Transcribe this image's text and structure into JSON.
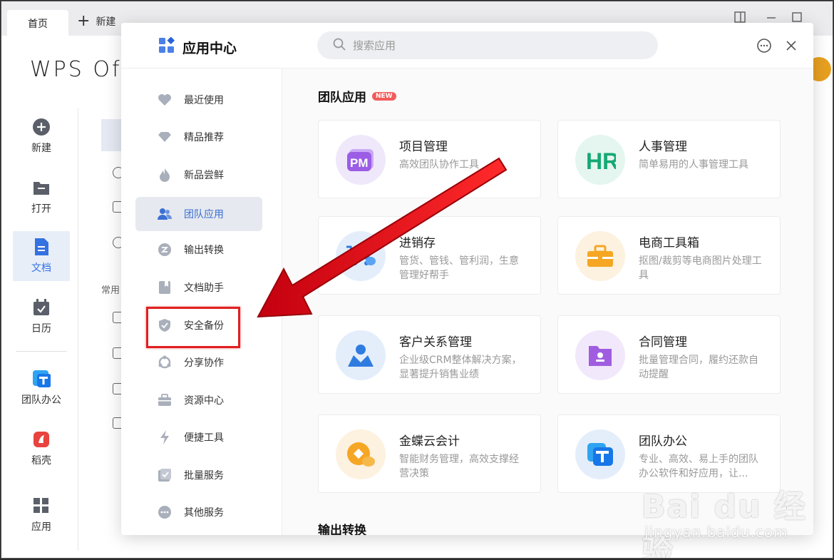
{
  "tabs": {
    "home": "首页",
    "new": "新建"
  },
  "logo": "WPS Off",
  "leftnav": [
    {
      "label": "新建",
      "icon": "plus-circle-icon"
    },
    {
      "label": "打开",
      "icon": "folder-icon"
    },
    {
      "label": "文档",
      "icon": "document-icon",
      "active": true
    },
    {
      "label": "日历",
      "icon": "calendar-icon"
    },
    {
      "label": "团队办公",
      "icon": "team-office-icon"
    },
    {
      "label": "稻壳",
      "icon": "docer-icon"
    },
    {
      "label": "应用",
      "icon": "apps-grid-icon"
    }
  ],
  "col2_label": "常用",
  "modal": {
    "title": "应用中心",
    "search_placeholder": "搜索应用"
  },
  "sidebar": [
    {
      "label": "最近使用",
      "icon": "heart-icon"
    },
    {
      "label": "精品推荐",
      "icon": "diamond-icon"
    },
    {
      "label": "新品尝鲜",
      "icon": "flame-icon"
    },
    {
      "label": "团队应用",
      "icon": "team-icon",
      "active": true
    },
    {
      "label": "输出转换",
      "icon": "convert-icon"
    },
    {
      "label": "文档助手",
      "icon": "doc-helper-icon"
    },
    {
      "label": "安全备份",
      "icon": "shield-icon"
    },
    {
      "label": "分享协作",
      "icon": "share-icon"
    },
    {
      "label": "资源中心",
      "icon": "briefcase-icon"
    },
    {
      "label": "便捷工具",
      "icon": "lightning-icon"
    },
    {
      "label": "批量服务",
      "icon": "batch-icon"
    },
    {
      "label": "其他服务",
      "icon": "more-icon"
    }
  ],
  "section1": {
    "title": "团队应用",
    "badge": "NEW"
  },
  "section2": {
    "title": "输出转换"
  },
  "cards": [
    {
      "name": "项目管理",
      "desc": "高效团队协作工具",
      "icon": "pm-icon"
    },
    {
      "name": "人事管理",
      "desc": "简单易用的人事管理工具",
      "icon": "hr-icon"
    },
    {
      "name": "进销存",
      "desc": "管货、管钱、管利润，生意管理好帮手",
      "icon": "inventory-icon"
    },
    {
      "name": "电商工具箱",
      "desc": "抠图/裁剪等电商图片处理工具",
      "icon": "toolbox-icon"
    },
    {
      "name": "客户关系管理",
      "desc": "企业级CRM整体解决方案，显著提升销售业绩",
      "icon": "crm-icon"
    },
    {
      "name": "合同管理",
      "desc": "批量管理合同，履约还款自动提醒",
      "icon": "contract-icon"
    },
    {
      "name": "金蝶云会计",
      "desc": "智能财务管理，高效支撑经营决策",
      "icon": "kingdee-icon"
    },
    {
      "name": "团队办公",
      "desc": "专业、高效、易上手的团队办公软件和好应用，让...",
      "icon": "team-office-app-icon"
    }
  ],
  "watermark": {
    "main": "Bai du 经验",
    "sub": "jingyan.baidu.com"
  }
}
